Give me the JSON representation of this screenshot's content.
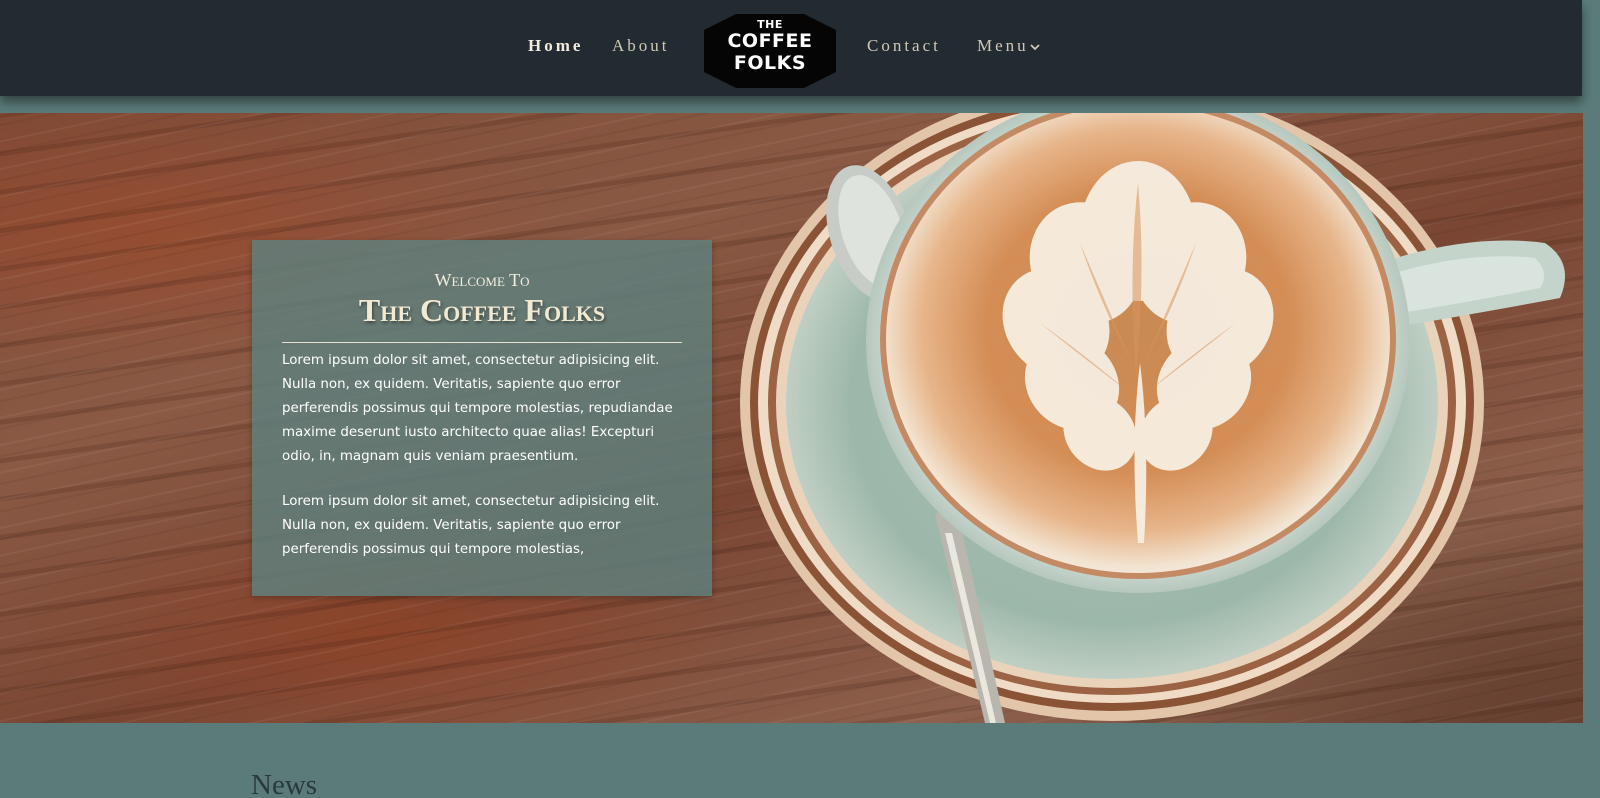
{
  "header": {
    "nav": {
      "home": "Home",
      "about": "About",
      "contact": "Contact",
      "menu": "Menu"
    },
    "logo": {
      "the": "THE",
      "coffee": "COFFEE",
      "folks": "FOLKS"
    }
  },
  "hero": {
    "welcome_sub": "Welcome To",
    "welcome_title": "The Coffee Folks",
    "paragraph1": "Lorem ipsum dolor sit amet, consectetur adipisicing elit. Nulla non, ex quidem. Veritatis, sapiente quo error perferendis possimus qui tempore molestias, repudiandae maxime deserunt iusto architecto quae alias! Excepturi odio, in, magnam quis veniam praesentium.",
    "paragraph2": "Lorem ipsum dolor sit amet, consectetur adipisicing elit. Nulla non, ex quidem. Veritatis, sapiente quo error perferendis possimus qui tempore molestias,"
  },
  "news": {
    "title": "News"
  },
  "colors": {
    "header_bg": "#222a32",
    "page_bg": "#5a7b7a",
    "box_bg": "#5f807e",
    "cream_text": "#f1e9d2"
  },
  "icons": {
    "menu_dropdown": "chevron-down-icon",
    "hero_photo": "latte-art-cup-image"
  }
}
